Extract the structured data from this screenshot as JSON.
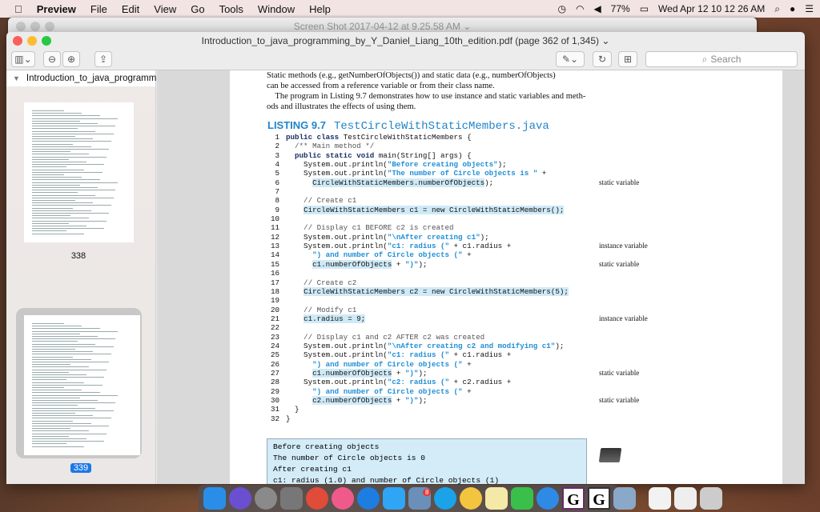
{
  "menubar": {
    "apple": "",
    "app": "Preview",
    "items": [
      "File",
      "Edit",
      "View",
      "Go",
      "Tools",
      "Window",
      "Help"
    ],
    "battery": "77%",
    "clock": "Wed Apr 12  10 12 26 AM"
  },
  "back_window": {
    "title": "Screen Shot 2017-04-12 at 9.25.58 AM ⌄"
  },
  "window": {
    "title": "Introduction_to_java_programming_by_Y_Daniel_Liang_10th_edition.pdf (page 362 of 1,345) ⌄",
    "search_placeholder": "Search"
  },
  "sidebar": {
    "doc_title": "Introduction_to_java_programmin...",
    "pages": [
      {
        "label": "338"
      },
      {
        "label": "339",
        "selected": true
      }
    ]
  },
  "page": {
    "prose": [
      "Static methods (e.g., getNumberOfObjects()) and static data (e.g., numberOfObjects)",
      "can be accessed from a reference variable or from their class name.",
      "    The program in Listing 9.7 demonstrates how to use instance and static variables and meth-",
      "ods and illustrates the effects of using them."
    ],
    "listing_label": "LISTING 9.7",
    "listing_file": "TestCircleWithStaticMembers.java",
    "code": [
      {
        "n": "1",
        "segs": [
          [
            "public class ",
            "kw"
          ],
          [
            "TestCircleWithStaticMembers {",
            ""
          ]
        ]
      },
      {
        "n": "2",
        "segs": [
          [
            "  /** Main method */",
            "cm"
          ]
        ]
      },
      {
        "n": "3",
        "segs": [
          [
            "  public static void ",
            "kw"
          ],
          [
            "main(String[] args) {",
            ""
          ]
        ]
      },
      {
        "n": "4",
        "segs": [
          [
            "    System.out.println(",
            ""
          ],
          [
            "\"Before creating objects\"",
            "str"
          ],
          [
            ");",
            ""
          ]
        ]
      },
      {
        "n": "5",
        "segs": [
          [
            "    System.out.println(",
            ""
          ],
          [
            "\"The number of Circle objects is \"",
            "str"
          ],
          [
            " +",
            ""
          ]
        ]
      },
      {
        "n": "6",
        "segs": [
          [
            "      ",
            ""
          ],
          [
            "CircleWithStaticMembers.numberOfObjects",
            "hl"
          ],
          [
            ");",
            ""
          ]
        ],
        "note": "static variable"
      },
      {
        "n": "7",
        "segs": []
      },
      {
        "n": "8",
        "segs": [
          [
            "    // Create c1",
            "cm"
          ]
        ]
      },
      {
        "n": "9",
        "segs": [
          [
            "    ",
            ""
          ],
          [
            "CircleWithStaticMembers c1 = new CircleWithStaticMembers();",
            "hl"
          ]
        ]
      },
      {
        "n": "10",
        "segs": []
      },
      {
        "n": "11",
        "segs": [
          [
            "    // Display c1 BEFORE c2 is created",
            "cm"
          ]
        ]
      },
      {
        "n": "12",
        "segs": [
          [
            "    System.out.println(",
            ""
          ],
          [
            "\"\\nAfter creating c1\"",
            "str"
          ],
          [
            ");",
            ""
          ]
        ]
      },
      {
        "n": "13",
        "segs": [
          [
            "    System.out.println(",
            ""
          ],
          [
            "\"c1: radius (\"",
            "str"
          ],
          [
            " + c1.radius +",
            ""
          ]
        ],
        "note": "instance variable"
      },
      {
        "n": "14",
        "segs": [
          [
            "      ",
            ""
          ],
          [
            "\") and number of Circle objects (\"",
            "str"
          ],
          [
            " +",
            ""
          ]
        ]
      },
      {
        "n": "15",
        "segs": [
          [
            "      ",
            ""
          ],
          [
            "c1.numberOfObjects",
            "hl"
          ],
          [
            " + ",
            ""
          ],
          [
            "\")\"",
            "str"
          ],
          [
            ");",
            ""
          ]
        ],
        "note": "static variable"
      },
      {
        "n": "16",
        "segs": []
      },
      {
        "n": "17",
        "segs": [
          [
            "    // Create c2",
            "cm"
          ]
        ]
      },
      {
        "n": "18",
        "segs": [
          [
            "    ",
            ""
          ],
          [
            "CircleWithStaticMembers c2 = new CircleWithStaticMembers(5);",
            "hl"
          ]
        ]
      },
      {
        "n": "19",
        "segs": []
      },
      {
        "n": "20",
        "segs": [
          [
            "    // Modify c1",
            "cm"
          ]
        ]
      },
      {
        "n": "21",
        "segs": [
          [
            "    ",
            ""
          ],
          [
            "c1.radius = 9;",
            "hl"
          ]
        ],
        "note": "instance variable"
      },
      {
        "n": "22",
        "segs": []
      },
      {
        "n": "23",
        "segs": [
          [
            "    // Display c1 and c2 AFTER c2 was created",
            "cm"
          ]
        ]
      },
      {
        "n": "24",
        "segs": [
          [
            "    System.out.println(",
            ""
          ],
          [
            "\"\\nAfter creating c2 and modifying c1\"",
            "str"
          ],
          [
            ");",
            ""
          ]
        ]
      },
      {
        "n": "25",
        "segs": [
          [
            "    System.out.println(",
            ""
          ],
          [
            "\"c1: radius (\"",
            "str"
          ],
          [
            " + c1.radius +",
            ""
          ]
        ]
      },
      {
        "n": "26",
        "segs": [
          [
            "      ",
            ""
          ],
          [
            "\") and number of Circle objects (\"",
            "str"
          ],
          [
            " +",
            ""
          ]
        ]
      },
      {
        "n": "27",
        "segs": [
          [
            "      ",
            ""
          ],
          [
            "c1.numberOfObjects",
            "hl"
          ],
          [
            " + ",
            ""
          ],
          [
            "\")\"",
            "str"
          ],
          [
            ");",
            ""
          ]
        ],
        "note": "static variable"
      },
      {
        "n": "28",
        "segs": [
          [
            "    System.out.println(",
            ""
          ],
          [
            "\"c2: radius (\"",
            "str"
          ],
          [
            " + c2.radius +",
            ""
          ]
        ]
      },
      {
        "n": "29",
        "segs": [
          [
            "      ",
            ""
          ],
          [
            "\") and number of Circle objects (\"",
            "str"
          ],
          [
            " +",
            ""
          ]
        ]
      },
      {
        "n": "30",
        "segs": [
          [
            "      ",
            ""
          ],
          [
            "c2.numberOfObjects",
            "hl"
          ],
          [
            " + ",
            ""
          ],
          [
            "\")\"",
            "str"
          ],
          [
            ");",
            ""
          ]
        ],
        "note": "static variable"
      },
      {
        "n": "31",
        "segs": [
          [
            "  }",
            ""
          ]
        ]
      },
      {
        "n": "32",
        "segs": [
          [
            "}",
            ""
          ]
        ]
      }
    ],
    "output": "Before creating objects\nThe number of Circle objects is 0\nAfter creating c1\nc1: radius (1.0) and number of Circle objects (1)"
  },
  "dock": {
    "apps": [
      "finder-icon",
      "siri-icon",
      "launchpad-icon",
      "system-preferences-icon",
      "chrome-icon",
      "itunes-icon",
      "app-store-icon",
      "messages-icon",
      "mail-icon",
      "skype-icon",
      "photos-icon",
      "notes-icon",
      "facetime-icon",
      "safari-icon",
      "g-app-icon",
      "g-app-2-icon",
      "preview-icon",
      "document-icon",
      "file-icon",
      "trash-icon"
    ],
    "colors": [
      "#2a8ee8",
      "#6a4fd0",
      "#8a8a8a",
      "#777",
      "#e04b3a",
      "#f05a8a",
      "#1e7de0",
      "#2ea5f5",
      "#6a8fb8",
      "#1aa3e8",
      "#f2c440",
      "#f5e9a8",
      "#3ac04a",
      "#2f8ae5",
      "#fff",
      "#fff",
      "#8aa8c8",
      "#f2f2f2",
      "#eee",
      "#ccc"
    ],
    "mail_badge": "8"
  }
}
